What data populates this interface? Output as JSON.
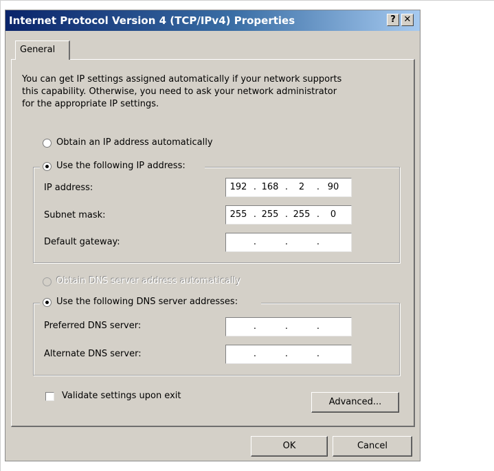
{
  "window": {
    "title": "Internet Protocol Version 4 (TCP/IPv4) Properties",
    "help_label": "?",
    "close_label": "✕"
  },
  "tabs": [
    {
      "label": "General",
      "active": true
    }
  ],
  "description": [
    "You can get IP settings assigned automatically if your network supports",
    "this capability. Otherwise, you need to ask your network administrator",
    "for the appropriate IP settings."
  ],
  "ip": {
    "auto_label": "Obtain an IP address automatically",
    "auto_selected": false,
    "manual_label": "Use the following IP address:",
    "manual_selected": true,
    "fields": [
      {
        "label": "IP address:",
        "octets": [
          "192",
          "168",
          "2",
          "90"
        ]
      },
      {
        "label": "Subnet mask:",
        "octets": [
          "255",
          "255",
          "255",
          "0"
        ]
      },
      {
        "label": "Default gateway:",
        "octets": [
          "",
          "",
          "",
          ""
        ]
      }
    ]
  },
  "dns": {
    "auto_label": "Obtain DNS server address automatically",
    "auto_selected": false,
    "auto_enabled": false,
    "manual_label": "Use the following DNS server addresses:",
    "manual_selected": true,
    "fields": [
      {
        "label": "Preferred DNS server:",
        "octets": [
          "",
          "",
          "",
          ""
        ]
      },
      {
        "label": "Alternate DNS server:",
        "octets": [
          "",
          "",
          "",
          ""
        ]
      }
    ]
  },
  "validate": {
    "label": "Validate settings upon exit",
    "checked": false
  },
  "buttons": {
    "advanced": "Advanced...",
    "ok": "OK",
    "cancel": "Cancel"
  },
  "ip_separator": "."
}
